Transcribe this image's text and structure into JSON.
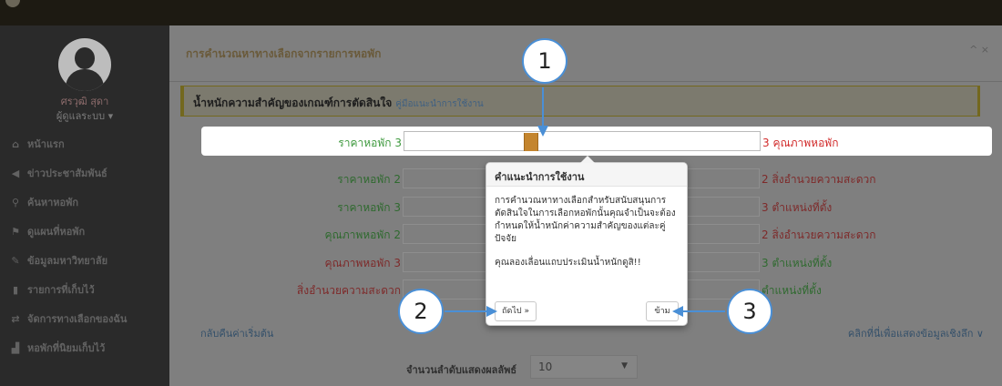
{
  "sidebar": {
    "user_name": "ศรวุฒิ สุดา",
    "user_role": "ผู้ดูแลระบบ ▾",
    "items": [
      {
        "icon": "home-icon",
        "glyph": "⌂",
        "label": "หน้าแรก"
      },
      {
        "icon": "megaphone-icon",
        "glyph": "◀",
        "label": "ข่าวประชาสัมพันธ์"
      },
      {
        "icon": "search-icon",
        "glyph": "⚲",
        "label": "ค้นหาหอพัก"
      },
      {
        "icon": "map-marker-icon",
        "glyph": "⚑",
        "label": "ดูแผนที่หอพัก"
      },
      {
        "icon": "graduation-cap-icon",
        "glyph": "✎",
        "label": "ข้อมูลมหาวิทยาลัย"
      },
      {
        "icon": "bookmark-icon",
        "glyph": "▮",
        "label": "รายการที่เก็บไว้"
      },
      {
        "icon": "exchange-icon",
        "glyph": "⇄",
        "label": "จัดการทางเลือกของฉัน"
      },
      {
        "icon": "bar-chart-icon",
        "glyph": "▟",
        "label": "หอพักที่นิยมเก็บไว้"
      }
    ]
  },
  "panel": {
    "title": "การคำนวณหาทางเลือกจากรายการหอพัก",
    "controls": "^ ×",
    "info_title": "น้ำหนักความสำคัญของเกณฑ์การตัดสินใจ",
    "info_link": "คู่มือแนะนำการใช้งาน"
  },
  "comparisons": [
    {
      "left": "ราคาหอพัก 3",
      "right": "3 คุณภาพหอพัก",
      "left_color": "green",
      "right_color": "red"
    },
    {
      "left": "ราคาหอพัก 2",
      "right": "2 สิ่งอำนวยความสะดวก",
      "left_color": "green",
      "right_color": "red"
    },
    {
      "left": "ราคาหอพัก 3",
      "right": "3 ตำแหน่งที่ตั้ง",
      "left_color": "green",
      "right_color": "red"
    },
    {
      "left": "คุณภาพหอพัก 2",
      "right": "2 สิ่งอำนวยความสะดวก",
      "left_color": "green",
      "right_color": "red"
    },
    {
      "left": "คุณภาพหอพัก 3",
      "right": "3 ตำแหน่งที่ตั้ง",
      "left_color": "red",
      "right_color": "green"
    },
    {
      "left": "สิ่งอำนวยความสะดวก",
      "right": "ตำแหน่งที่ตั้ง",
      "left_color": "red",
      "right_color": "green"
    }
  ],
  "footer": {
    "reset_link": "กลับคืนค่าเริ่มต้น",
    "detail_link": "คลิกที่นี่เพื่อแสดงข้อมูลเชิงลึก ∨",
    "count_label": "จำนวนลำดับแสดงผลลัพธ์",
    "count_value": "10"
  },
  "popover": {
    "title": "คำแนะนำการใช้งาน",
    "body1": "การคำนวณหาทางเลือกสำหรับสนับสนุนการตัดสินใจในการเลือกหอพักนั้นคุณจำเป็นจะต้องกำหนดให้น้ำหนักค่าความสำคัญของแต่ละคู่ปัจจัย",
    "body2": "คุณลองเลื่อนแถบประเมินน้ำหนักดูสิ!!",
    "next_button": "ถัดไป »",
    "skip_button": "ข้าม"
  },
  "callouts": [
    "1",
    "2",
    "3"
  ],
  "colors": {
    "callout_border": "#4a8fd6",
    "slider_handle": "#c4852e",
    "green_label": "#3f9a3f",
    "red_label": "#d12b2b"
  }
}
